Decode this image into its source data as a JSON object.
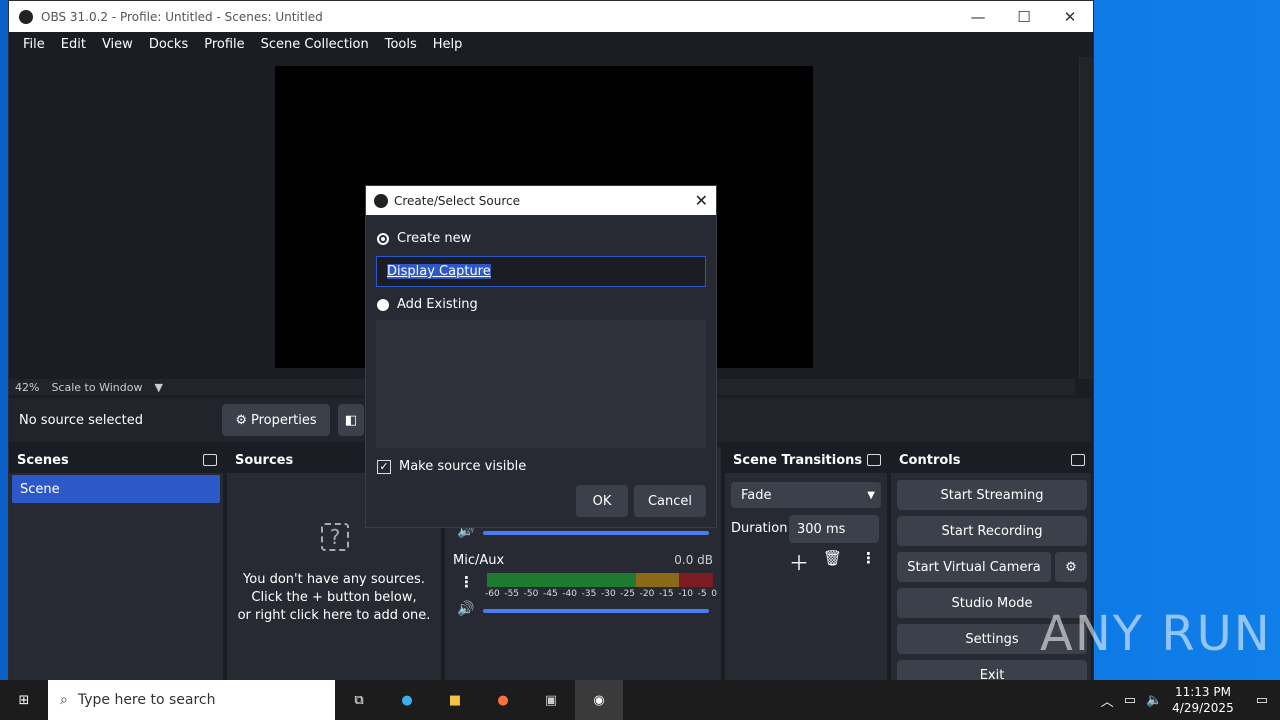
{
  "window": {
    "title": "OBS 31.0.2 - Profile: Untitled - Scenes: Untitled"
  },
  "menu": [
    "File",
    "Edit",
    "View",
    "Docks",
    "Profile",
    "Scene Collection",
    "Tools",
    "Help"
  ],
  "preview": {
    "zoom": "42%",
    "scale_mode": "Scale to Window"
  },
  "source_bar": {
    "no_source": "No source selected",
    "properties": "Properties"
  },
  "scenes": {
    "title": "Scenes",
    "items": [
      "Scene"
    ]
  },
  "sources": {
    "title": "Sources",
    "empty_line1": "You don't have any sources.",
    "empty_line2": "Click the + button below,",
    "empty_line3": "or right click here to add one."
  },
  "mixer": {
    "channel_name": "Mic/Aux",
    "channel_db": "0.0 dB",
    "scale_labels": [
      "-60",
      "-55",
      "-50",
      "-45",
      "-40",
      "-35",
      "-30",
      "-25",
      "-20",
      "-15",
      "-10",
      "-5",
      "0"
    ]
  },
  "transitions": {
    "title": "Scene Transitions",
    "type": "Fade",
    "duration_label": "Duration",
    "duration_value": "300 ms"
  },
  "controls": {
    "title": "Controls",
    "start_streaming": "Start Streaming",
    "start_recording": "Start Recording",
    "start_virtual_camera": "Start Virtual Camera",
    "studio_mode": "Studio Mode",
    "settings": "Settings",
    "exit": "Exit"
  },
  "dialog": {
    "title": "Create/Select Source",
    "create_new": "Create new",
    "name_value": "Display Capture",
    "add_existing": "Add Existing",
    "make_visible": "Make source visible",
    "ok": "OK",
    "cancel": "Cancel"
  },
  "taskbar": {
    "search_placeholder": "Type here to search",
    "time": "11:13 PM",
    "date": "4/29/2025"
  },
  "watermark": "ANY RUN"
}
